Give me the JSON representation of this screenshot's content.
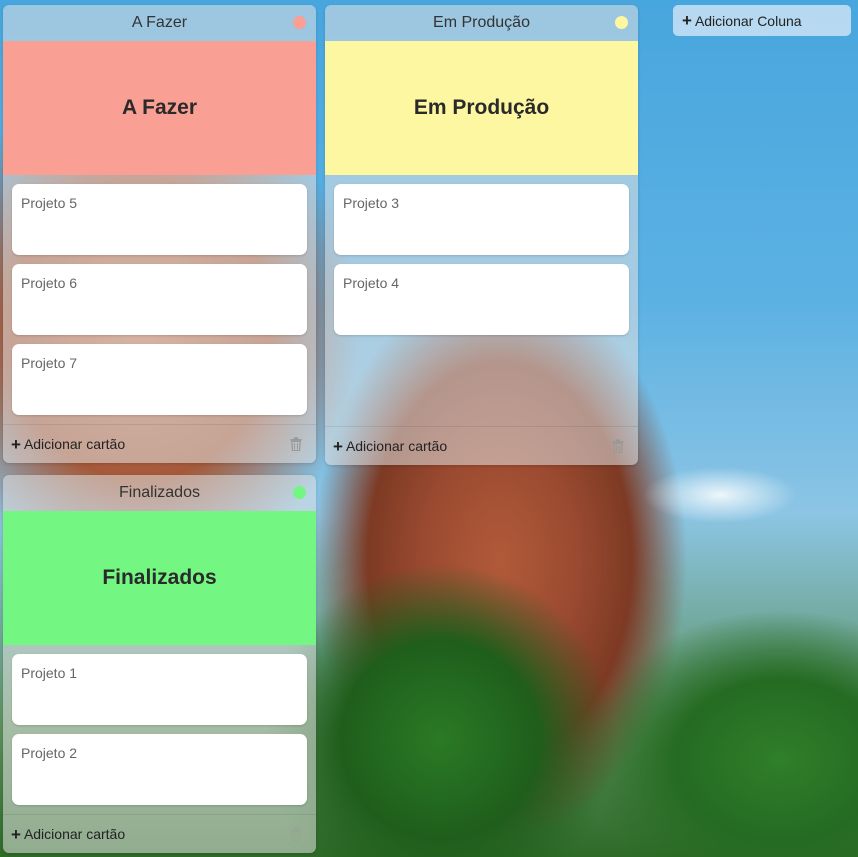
{
  "columns": [
    {
      "title": "A Fazer",
      "banner": "A Fazer",
      "color": "#f99f93",
      "dot": "#f99f93",
      "cards": [
        "Projeto 5",
        "Projeto 6",
        "Projeto 7"
      ],
      "add_card_label": "Adicionar cartão"
    },
    {
      "title": "Em Produção",
      "banner": "Em Produção",
      "color": "#fdf7a1",
      "dot": "#fdf7a1",
      "cards": [
        "Projeto 3",
        "Projeto 4"
      ],
      "add_card_label": "Adicionar cartão"
    },
    {
      "title": "Finalizados",
      "banner": "Finalizados",
      "color": "#74f683",
      "dot": "#74f683",
      "cards": [
        "Projeto 1",
        "Projeto 2"
      ],
      "add_card_label": "Adicionar cartão"
    }
  ],
  "add_column_label": "Adicionar Coluna",
  "icons": {
    "add": "plus-icon",
    "delete": "trash-icon"
  }
}
